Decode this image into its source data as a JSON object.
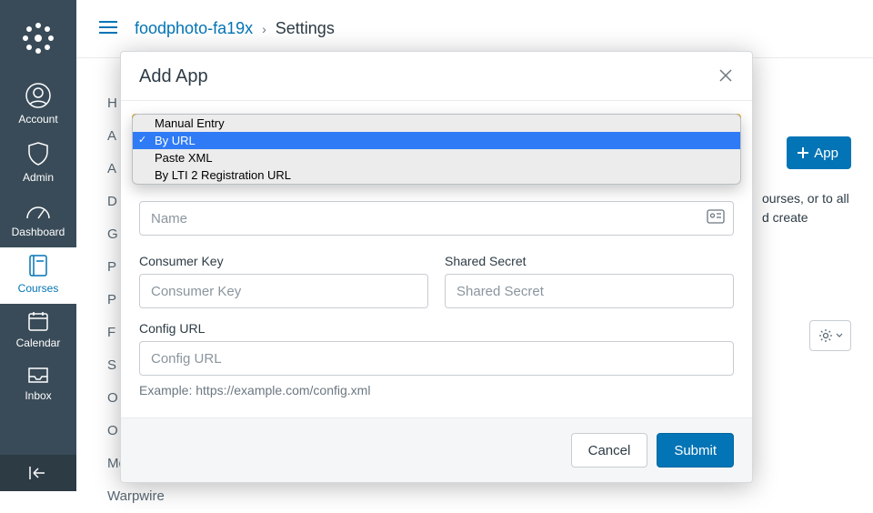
{
  "nav": {
    "items": [
      {
        "key": "account",
        "label": "Account"
      },
      {
        "key": "admin",
        "label": "Admin"
      },
      {
        "key": "dashboard",
        "label": "Dashboard"
      },
      {
        "key": "courses",
        "label": "Courses"
      },
      {
        "key": "calendar",
        "label": "Calendar"
      },
      {
        "key": "inbox",
        "label": "Inbox"
      }
    ]
  },
  "breadcrumb": {
    "course": "foodphoto-fa19x",
    "current": "Settings"
  },
  "background": {
    "left_items": [
      "H",
      "A",
      "A",
      "D",
      "G",
      "P",
      "P",
      "F",
      "S",
      "O",
      "O",
      "Modules",
      "Warpwire"
    ],
    "app_button": "App",
    "para_line1": "ourses, or to all",
    "para_line2": "d create"
  },
  "modal": {
    "title": "Add App",
    "config_type": {
      "options": [
        "Manual Entry",
        "By URL",
        "Paste XML",
        "By LTI 2 Registration URL"
      ],
      "selected": "By URL"
    },
    "name": {
      "label": "Name",
      "placeholder": "Name",
      "value": ""
    },
    "consumer_key": {
      "label": "Consumer Key",
      "placeholder": "Consumer Key",
      "value": ""
    },
    "shared_secret": {
      "label": "Shared Secret",
      "placeholder": "Shared Secret",
      "value": ""
    },
    "config_url": {
      "label": "Config URL",
      "placeholder": "Config URL",
      "value": "",
      "hint": "Example: https://example.com/config.xml"
    },
    "buttons": {
      "cancel": "Cancel",
      "submit": "Submit"
    }
  }
}
